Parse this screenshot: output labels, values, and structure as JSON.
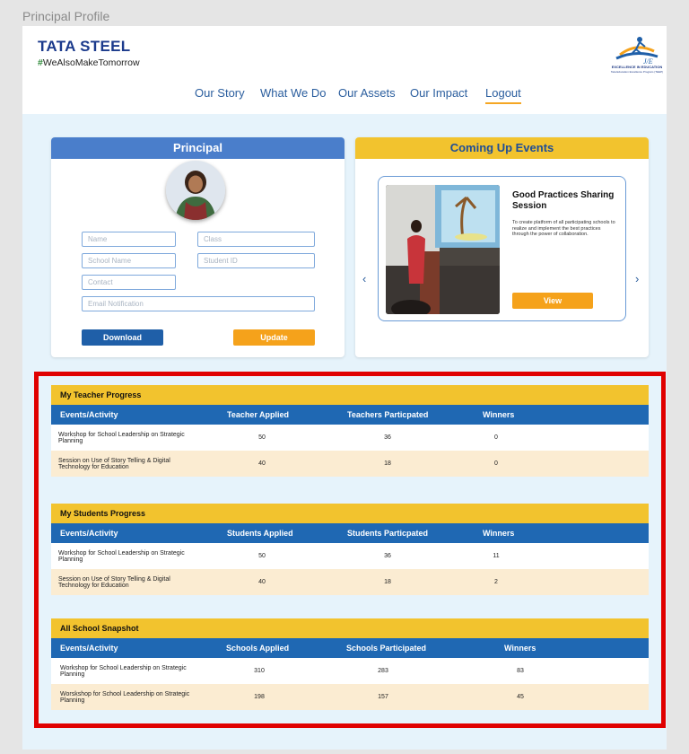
{
  "page_caption": "Principal Profile",
  "brand": {
    "name": "TATA STEEL",
    "hash": "#",
    "tagline": "WeAlsoMakeTomorrow"
  },
  "badge_logo": {
    "text_line1": "EXCELLENCE IN EDUCATION",
    "text_line2": "Tata Education Excellence Program (TEEP)"
  },
  "nav": {
    "items": [
      "Our Story",
      "What We Do",
      "Our Assets",
      "Our Impact",
      "Logout"
    ],
    "active": "Logout"
  },
  "principal": {
    "title": "Principal",
    "fields": {
      "name": "Name",
      "class": "Class",
      "school_name": "School Name",
      "student_id": "Student ID",
      "contact": "Contact",
      "email": "Email Notification"
    },
    "download_label": "Download",
    "update_label": "Update"
  },
  "events": {
    "title": "Coming Up Events",
    "event_title": "Good Practices Sharing Session",
    "event_desc": "To create platform of all participating schools to realize and implement the best practices through the power of collaboration.",
    "view_label": "View",
    "prev_arrow": "‹",
    "next_arrow": "›"
  },
  "teacher_progress": {
    "title": "My Teacher Progress",
    "headers": [
      "Events/Activity",
      "Teacher Applied",
      "Teachers Particpated",
      "Winners"
    ],
    "rows": [
      [
        "Workshop for School Leadership on Strategic Planning",
        "50",
        "36",
        "0"
      ],
      [
        "Session on Use of Story Telling & Digital Technology for Education",
        "40",
        "18",
        "0"
      ]
    ]
  },
  "student_progress": {
    "title": "My Students Progress",
    "headers": [
      "Events/Activity",
      "Students Applied",
      "Students Particpated",
      "Winners"
    ],
    "rows": [
      [
        "Workshop for School Leadership on Strategic Planning",
        "50",
        "36",
        "11"
      ],
      [
        "Session on Use of Story Telling & Digital Technology for Education",
        "40",
        "18",
        "2"
      ]
    ]
  },
  "school_snapshot": {
    "title": "All School Snapshot",
    "headers": [
      "Events/Activity",
      "Schools Applied",
      "Schools Participated",
      "Winners"
    ],
    "rows": [
      [
        "Workshop for School Leadership on Strategic Planning",
        "310",
        "283",
        "83"
      ],
      [
        "Worskshop for School Leadership on Strategic Planning",
        "198",
        "157",
        "45"
      ]
    ]
  },
  "colors": {
    "nav_text": "#2b5e9e",
    "principal_header": "#4a7ecb",
    "events_header": "#f2c32e",
    "table_header": "#1f68b3",
    "accent_orange": "#f5a21b",
    "highlight_border": "#e00000"
  }
}
